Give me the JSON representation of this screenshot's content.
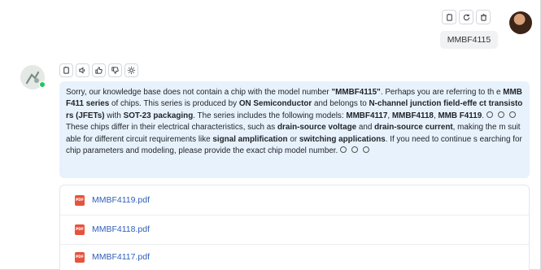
{
  "user_message": {
    "text": "MMBF4115",
    "tools": [
      "copy-icon",
      "refresh-icon",
      "trash-icon"
    ]
  },
  "assistant": {
    "tools": [
      "copy-icon",
      "speaker-icon",
      "thumbs-up-icon",
      "thumbs-down-icon",
      "sparkle-icon"
    ],
    "answer": {
      "p1_a": "Sorry, our knowledge base does not contain a chip with the model number ",
      "p1_b": "\"MMBF4115\"",
      "p1_c": ". Perhaps you are referring to th e ",
      "p1_d": "MMBF411 series",
      "p1_e": " of chips. This series is produced by ",
      "p1_f": "ON Semiconductor",
      "p1_g": " and belongs to ",
      "p1_h": "N-channel junction field-effe ct transistors (JFETs)",
      "p1_i": " with ",
      "p1_j": "SOT-23 packaging",
      "p1_k": ". The series includes the following models: ",
      "p1_l": "MMBF4117",
      "p1_m": ", ",
      "p1_n": "MMBF4118",
      "p1_o": ", ",
      "p1_p": "MMB F4119",
      "p1_q": ".",
      "p2_a": "These chips differ in their electrical characteristics, such as ",
      "p2_b": "drain-source voltage",
      "p2_c": " and ",
      "p2_d": "drain-source current",
      "p2_e": ", making the m suitable for different circuit requirements like ",
      "p2_f": "signal amplification",
      "p2_g": " or ",
      "p2_h": "switching applications",
      "p2_i": ". If you need to continue s earching for chip parameters and modeling, please provide the exact chip model number."
    },
    "ref_marker": "①",
    "files": [
      {
        "name": "MMBF4119.pdf",
        "icon": "pdf-icon",
        "icon_text": "PDF"
      },
      {
        "name": "MMBF4118.pdf",
        "icon": "pdf-icon",
        "icon_text": "PDF"
      },
      {
        "name": "MMBF4117.pdf",
        "icon": "pdf-icon",
        "icon_text": "PDF"
      }
    ]
  },
  "colors": {
    "answer_bg": "#e8f2fc",
    "link": "#2f5fb8",
    "pdf": "#e5533d",
    "online": "#22c55e"
  }
}
